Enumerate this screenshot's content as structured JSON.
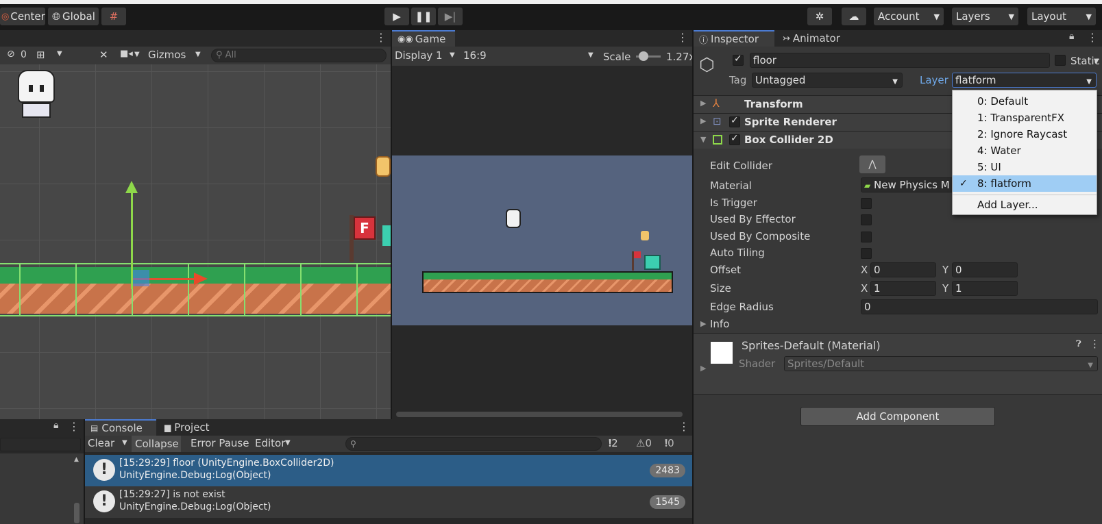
{
  "toolbar": {
    "pivot_label": "Center",
    "space_label": "Global",
    "account_label": "Account",
    "layers_label": "Layers",
    "layout_label": "Layout"
  },
  "scene": {
    "hidden_count": "0",
    "gizmos_label": "Gizmos",
    "search_placeholder": "All"
  },
  "game": {
    "tab_label": "Game",
    "display_label": "Display 1",
    "aspect_label": "16:9",
    "scale_label": "Scale",
    "scale_value": "1.27x"
  },
  "inspector": {
    "tab_label": "Inspector",
    "animator_tab_label": "Animator",
    "object_name": "floor",
    "static_label": "Static",
    "tag_label": "Tag",
    "tag_value": "Untagged",
    "layer_label": "Layer",
    "layer_value": "flatform",
    "components": {
      "transform": "Transform",
      "sprite_renderer": "Sprite Renderer",
      "box_collider": "Box Collider 2D"
    },
    "props": {
      "edit_collider": "Edit Collider",
      "material": "Material",
      "material_value": "New Physics M",
      "is_trigger": "Is Trigger",
      "used_by_effector": "Used By Effector",
      "used_by_composite": "Used By Composite",
      "auto_tiling": "Auto Tiling",
      "offset": "Offset",
      "offset_x": "0",
      "offset_y": "0",
      "size": "Size",
      "size_x": "1",
      "size_y": "1",
      "edge_radius": "Edge Radius",
      "edge_radius_value": "0",
      "info": "Info",
      "x": "X",
      "y": "Y"
    },
    "material_block": {
      "title": "Sprites-Default (Material)",
      "shader_label": "Shader",
      "shader_value": "Sprites/Default"
    },
    "add_component": "Add Component"
  },
  "layer_dropdown": {
    "items": [
      "0: Default",
      "1: TransparentFX",
      "2: Ignore Raycast",
      "4: Water",
      "5: UI",
      "8: flatform"
    ],
    "selected_index": 5,
    "add_layer": "Add Layer..."
  },
  "console": {
    "tab_label": "Console",
    "project_tab_label": "Project",
    "clear": "Clear",
    "collapse": "Collapse",
    "error_pause": "Error Pause",
    "editor": "Editor",
    "count_log": "2",
    "count_warn": "0",
    "count_error": "0",
    "entries": [
      {
        "line1": "[15:29:29] floor (UnityEngine.BoxCollider2D)",
        "line2": "UnityEngine.Debug:Log(Object)",
        "count": "2483"
      },
      {
        "line1": "[15:29:27]  is not exist",
        "line2": "UnityEngine.Debug:Log(Object)",
        "count": "1545"
      }
    ]
  }
}
